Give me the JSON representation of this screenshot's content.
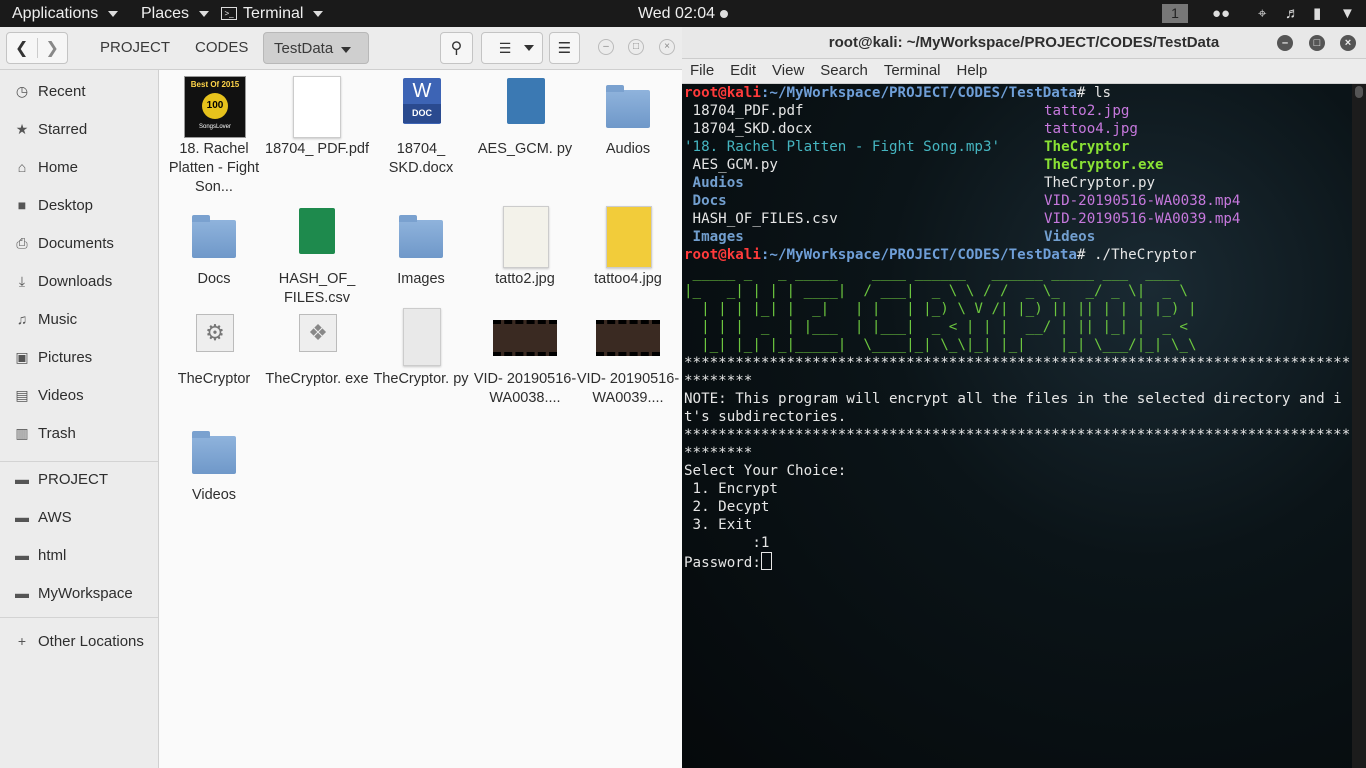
{
  "topbar": {
    "applications": "Applications",
    "places": "Places",
    "terminal": "Terminal",
    "clock": "Wed 02:04",
    "workspace": "1"
  },
  "files": {
    "breadcrumbs": [
      "PROJECT",
      "CODES",
      "TestData"
    ],
    "sidebar": [
      {
        "label": "Recent",
        "icon": "clock-icon"
      },
      {
        "label": "Starred",
        "icon": "star-icon"
      },
      {
        "label": "Home",
        "icon": "home-icon"
      },
      {
        "label": "Desktop",
        "icon": "desktop-icon"
      },
      {
        "label": "Documents",
        "icon": "document-icon"
      },
      {
        "label": "Downloads",
        "icon": "download-icon"
      },
      {
        "label": "Music",
        "icon": "music-icon"
      },
      {
        "label": "Pictures",
        "icon": "pictures-icon"
      },
      {
        "label": "Videos",
        "icon": "video-icon"
      },
      {
        "label": "Trash",
        "icon": "trash-icon"
      },
      {
        "label": "PROJECT",
        "icon": "folder-icon"
      },
      {
        "label": "AWS",
        "icon": "folder-icon"
      },
      {
        "label": "html",
        "icon": "folder-icon"
      },
      {
        "label": "MyWorkspace",
        "icon": "folder-icon"
      },
      {
        "label": "Other Locations",
        "icon": "plus-icon"
      }
    ],
    "items": [
      {
        "name": "18. Rachel Platten - Fight Son...",
        "kind": "audio"
      },
      {
        "name": "18704_ PDF.pdf",
        "kind": "pdf"
      },
      {
        "name": "18704_ SKD.docx",
        "kind": "doc"
      },
      {
        "name": "AES_GCM. py",
        "kind": "python"
      },
      {
        "name": "Audios",
        "kind": "folder"
      },
      {
        "name": "Docs",
        "kind": "folder"
      },
      {
        "name": "HASH_OF_ FILES.csv",
        "kind": "csv"
      },
      {
        "name": "Images",
        "kind": "folder"
      },
      {
        "name": "tatto2.jpg",
        "kind": "image"
      },
      {
        "name": "tattoo4.jpg",
        "kind": "image2"
      },
      {
        "name": "TheCryptor",
        "kind": "exec"
      },
      {
        "name": "TheCryptor. exe",
        "kind": "exe"
      },
      {
        "name": "TheCryptor. py",
        "kind": "text"
      },
      {
        "name": "VID- 20190516- WA0038....",
        "kind": "video"
      },
      {
        "name": "VID- 20190516- WA0039....",
        "kind": "video"
      },
      {
        "name": "Videos",
        "kind": "folder"
      }
    ],
    "album_art": {
      "title": "Best Of 2015",
      "badge": "100",
      "brand": "SongsLover"
    },
    "doc_badge": "DOC",
    "doc_letter": "W"
  },
  "terminal": {
    "title": "root@kali: ~/MyWorkspace/PROJECT/CODES/TestData",
    "menu": [
      "File",
      "Edit",
      "View",
      "Search",
      "Terminal",
      "Help"
    ],
    "prompt_user": "root@kali",
    "prompt_path": ":~/MyWorkspace/PROJECT/CODES/TestData",
    "cmd1": "# ls",
    "cmd2": "# ./TheCryptor",
    "ls_left": [
      {
        "t": " 18704_PDF.pdf",
        "c": ""
      },
      {
        "t": " 18704_SKD.docx",
        "c": ""
      },
      {
        "t": "'18. Rachel Platten - Fight Song.mp3'",
        "c": "cyan"
      },
      {
        "t": " AES_GCM.py",
        "c": ""
      },
      {
        "t": " Audios",
        "c": "blue"
      },
      {
        "t": " Docs",
        "c": "blue"
      },
      {
        "t": " HASH_OF_FILES.csv",
        "c": ""
      },
      {
        "t": " Images",
        "c": "blue"
      }
    ],
    "ls_right": [
      {
        "t": "tatto2.jpg",
        "c": "purple"
      },
      {
        "t": "tattoo4.jpg",
        "c": "purple"
      },
      {
        "t": "TheCryptor",
        "c": "green"
      },
      {
        "t": "TheCryptor.exe",
        "c": "green"
      },
      {
        "t": "TheCryptor.py",
        "c": ""
      },
      {
        "t": "VID-20190516-WA0038.mp4",
        "c": "purple"
      },
      {
        "t": "VID-20190516-WA0039.mp4",
        "c": "purple"
      },
      {
        "t": "Videos",
        "c": "blue"
      }
    ],
    "banner": [
      " _____ _   _ _____    ____ ______   ______ _____ ___  ____  ",
      "|_   _| | | | ____|  / ___|  _ \\ \\ / /  _ \\_   _/ _ \\|  _ \\ ",
      "  | | | |_| |  _|   | |   | |_) \\ V /| |_) || || | | | |_) |",
      "  | | |  _  | |___  | |___|  _ < | | |  __/ | || |_| |  _ < ",
      "  |_| |_| |_|_____|  \\____|_| \\_\\|_| |_|    |_| \\___/|_| \\_\\"
    ],
    "stars1": "**************************************************************************************",
    "note": "NOTE: This program will encrypt all the files in the selected directory and it's subdirectories.",
    "stars2": "**************************************************************************************",
    "menu_title": "Select Your Choice:",
    "options": [
      " 1. Encrypt",
      " 2. Decypt",
      " 3. Exit"
    ],
    "choice": "        :1",
    "password": "Password:"
  }
}
